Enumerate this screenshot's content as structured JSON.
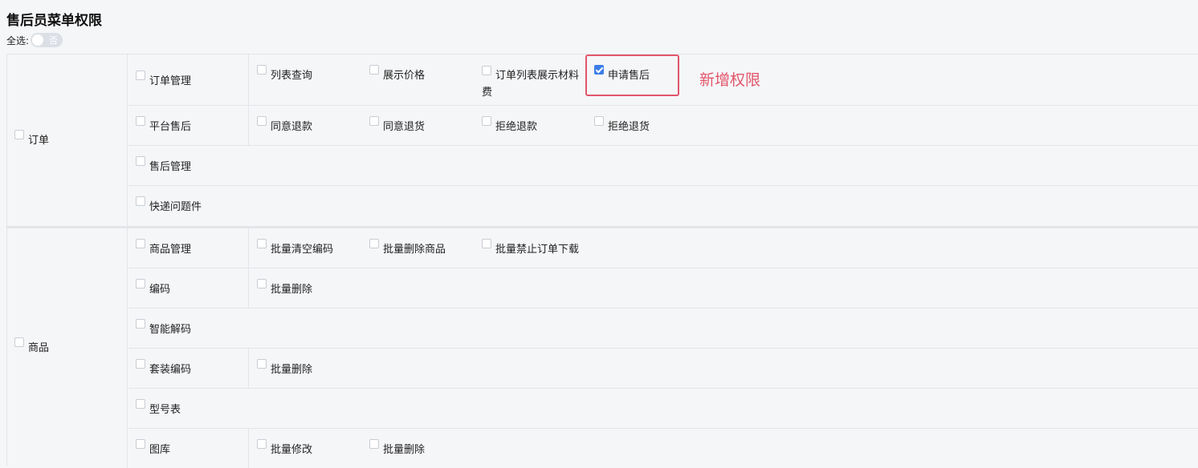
{
  "title": "售后员菜单权限",
  "select_all": {
    "label": "全选:",
    "toggle_text": "否"
  },
  "annotation": "新增权限",
  "groups": {
    "order": {
      "label": "订单",
      "rows": {
        "order_mgmt": {
          "label": "订单管理",
          "perms": [
            "列表查询",
            "展示价格",
            "订单列表展示材料费",
            "申请售后"
          ]
        },
        "platform_after_sale": {
          "label": "平台售后",
          "perms": [
            "同意退款",
            "同意退货",
            "拒绝退款",
            "拒绝退货"
          ]
        },
        "after_sale_mgmt": {
          "label": "售后管理"
        },
        "express_issues": {
          "label": "快递问题件"
        }
      }
    },
    "goods": {
      "label": "商品",
      "rows": {
        "goods_mgmt": {
          "label": "商品管理",
          "perms": [
            "批量清空编码",
            "批量删除商品",
            "批量禁止订单下载"
          ]
        },
        "code": {
          "label": "编码",
          "perms": [
            "批量删除"
          ]
        },
        "smart_decode": {
          "label": "智能解码"
        },
        "set_code": {
          "label": "套装编码",
          "perms": [
            "批量删除"
          ]
        },
        "model_table": {
          "label": "型号表"
        },
        "gallery": {
          "label": "图库",
          "perms": [
            "批量修改",
            "批量删除"
          ]
        }
      }
    }
  },
  "checked_perm": "申请售后",
  "colors": {
    "accent": "#3b7de8",
    "annotation": "#e2566b",
    "border": "#e3e5e9",
    "background": "#f5f6f8"
  }
}
